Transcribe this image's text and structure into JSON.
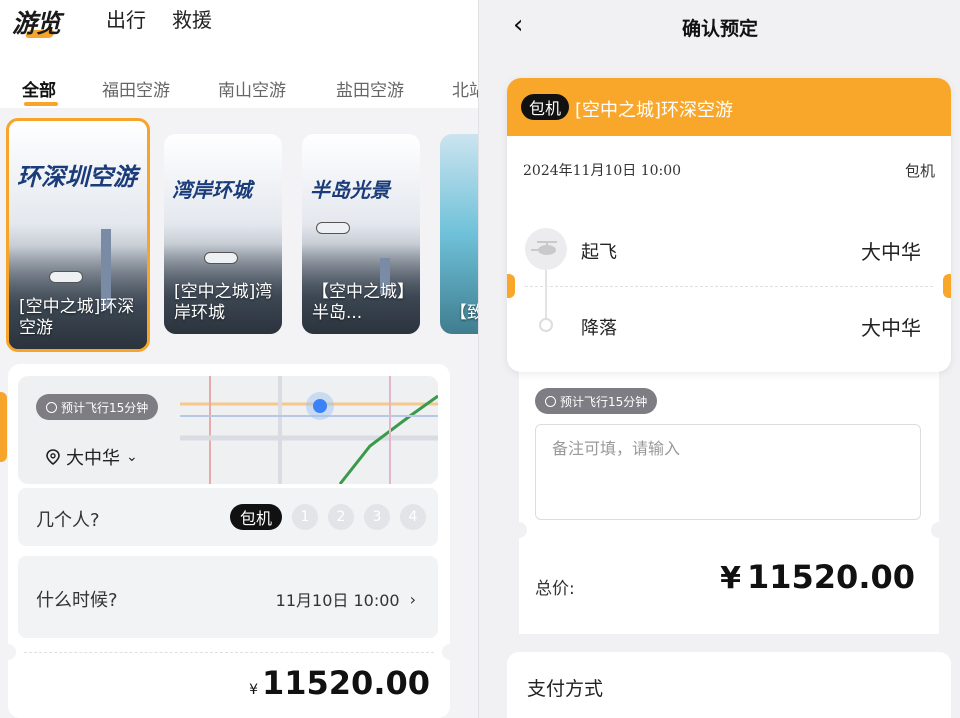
{
  "left": {
    "logo": "游览",
    "nav": [
      "出行",
      "救援"
    ],
    "tabs": [
      "全部",
      "福田空游",
      "南山空游",
      "盐田空游",
      "北站"
    ],
    "cards": [
      {
        "brand": "环深圳空游",
        "title": "[空中之城]环深空游"
      },
      {
        "brand": "湾岸环城",
        "title": "[空中之城]湾岸环城"
      },
      {
        "brand": "半岛光景",
        "title": "【空中之城】半岛..."
      },
      {
        "brand": "",
        "title": "【致岸】"
      }
    ],
    "flight_pill": "预计飞行15分钟",
    "location": "大中华",
    "people_label": "几个人?",
    "charter_chip": "包机",
    "people_options": [
      "1",
      "2",
      "3",
      "4"
    ],
    "time_label": "什么时候?",
    "time_value": "11月10日 10:00",
    "price_symbol": "¥",
    "price": "11520.00"
  },
  "right": {
    "title": "确认预定",
    "badge": "包机",
    "product": "[空中之城]环深空游",
    "date": "2024年11月10日   10:00",
    "type": "包机",
    "takeoff_label": "起飞",
    "takeoff_value": "大中华",
    "landing_label": "降落",
    "landing_value": "大中华",
    "flight_pill": "预计飞行15分钟",
    "note_placeholder": "备注可填，请输入",
    "total_label": "总价:",
    "total_symbol": "¥",
    "total_value": "11520.00",
    "payment_label": "支付方式"
  },
  "colors": {
    "accent": "#f8a72b",
    "dark": "#111111"
  }
}
